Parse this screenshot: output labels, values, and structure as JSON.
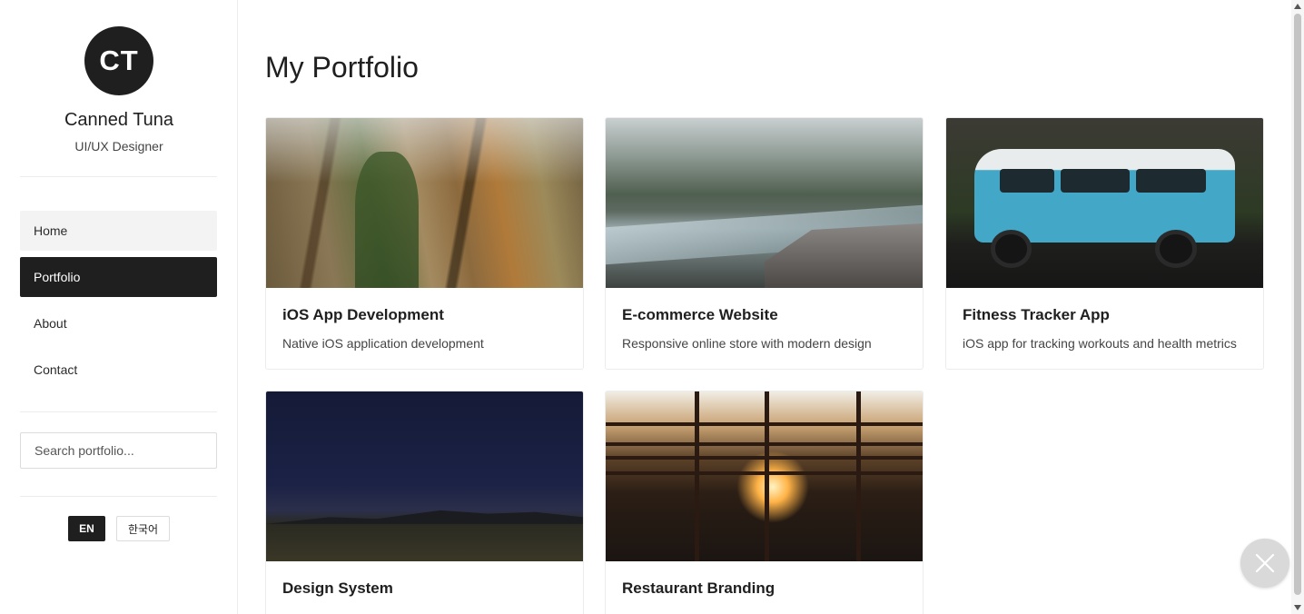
{
  "sidebar": {
    "avatar_initials": "CT",
    "name": "Canned Tuna",
    "role": "UI/UX Designer",
    "nav": [
      {
        "label": "Home"
      },
      {
        "label": "Portfolio"
      },
      {
        "label": "About"
      },
      {
        "label": "Contact"
      }
    ],
    "search_placeholder": "Search portfolio...",
    "languages": [
      {
        "label": "EN"
      },
      {
        "label": "한국어"
      }
    ]
  },
  "main": {
    "title": "My Portfolio",
    "cards": [
      {
        "title": "iOS App Development",
        "description": "Native iOS application development",
        "image": "rock-cliffs-photo"
      },
      {
        "title": "E-commerce Website",
        "description": "Responsive online store with modern design",
        "image": "mountain-river-photo"
      },
      {
        "title": "Fitness Tracker App",
        "description": "iOS app for tracking workouts and health metrics",
        "image": "blue-van-photo"
      },
      {
        "title": "Design System",
        "description": "",
        "image": "night-sky-photo"
      },
      {
        "title": "Restaurant Branding",
        "description": "",
        "image": "sunset-highway-photo"
      }
    ]
  },
  "floating": {
    "icon": "close-icon"
  },
  "colors": {
    "accent": "#1f1f1f",
    "active_nav_text": "#ffffff",
    "hover_nav": "#f3f3f3"
  }
}
